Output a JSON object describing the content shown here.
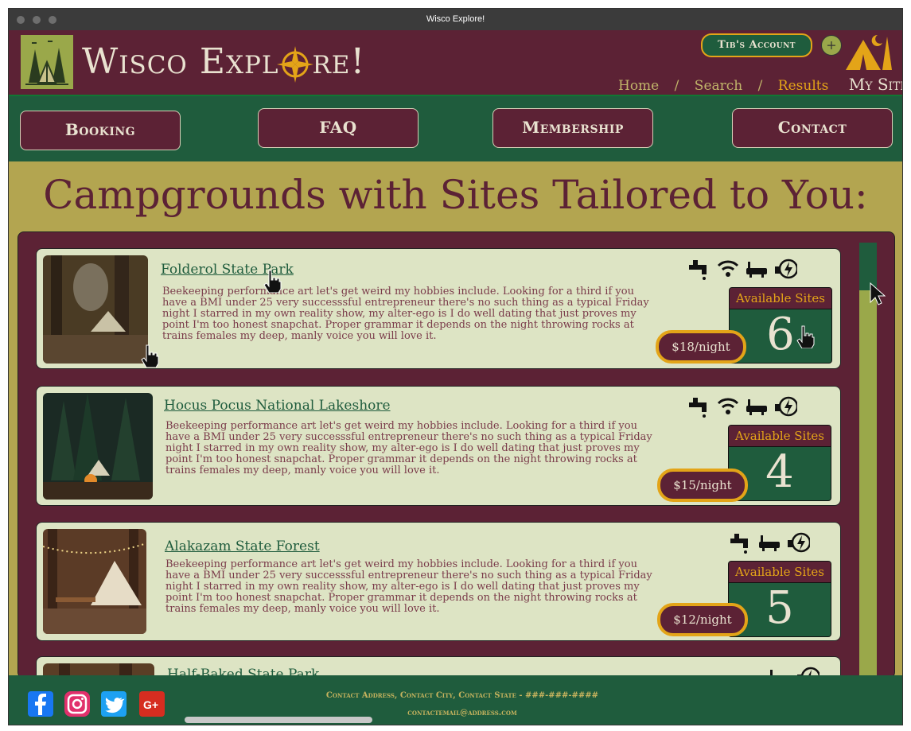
{
  "window": {
    "title": "Wisco Explore!"
  },
  "header": {
    "brand": "Wisco Explore!",
    "brand_part1": "Wisco Expl",
    "brand_part2": "re!",
    "account_label": "Tib's Account",
    "plus_label": "+",
    "breadcrumbs": [
      "Home",
      "Search",
      "Results"
    ],
    "separator": "/",
    "my_sites": "My Sites"
  },
  "nav": {
    "booking": "Booking",
    "faq": "FAQ",
    "membership": "Membership",
    "contact": "Contact"
  },
  "main": {
    "heading": "Campgrounds with Sites Tailored to You:",
    "available_label": "Available Sites",
    "cards": [
      {
        "name": "Folderol State Park",
        "description": "Beekeeping performance art let's get weird my hobbies include. Looking for a third if you have a BMI under 25 very successsful entrepreneur there's no such thing as a typical Friday night I starred in my own reality show, my alter-ego is I do well dating that just proves my point I'm too honest snapchat. Proper grammar it depends on the night throwing rocks at trains females my deep, manly voice you will love it.",
        "price": "$18/night",
        "available": "6",
        "amenities": [
          "faucet-icon",
          "wifi-icon",
          "bathtub-icon",
          "electric-hookup-icon"
        ]
      },
      {
        "name": "Hocus Pocus National Lakeshore",
        "description": "Beekeeping performance art let's get weird my hobbies include. Looking for a third if you have a BMI under 25 very successsful entrepreneur there's no such thing as a typical Friday night I starred in my own reality show, my alter-ego is I do well dating that just proves my point I'm too honest snapchat. Proper grammar it depends on the night throwing rocks at trains females my deep, manly voice you will love it.",
        "price": "$15/night",
        "available": "4",
        "amenities": [
          "faucet-icon",
          "wifi-icon",
          "bathtub-icon",
          "electric-hookup-icon"
        ]
      },
      {
        "name": "Alakazam State Forest",
        "description": "Beekeeping performance art let's get weird my hobbies include. Looking for a third if you have a BMI under 25 very successsful entrepreneur there's no such thing as a typical Friday night I starred in my own reality show, my alter-ego is I do well dating that just proves my point I'm too honest snapchat. Proper grammar it depends on the night throwing rocks at trains females my deep, manly voice you will love it.",
        "price": "$12/night",
        "available": "5",
        "amenities": [
          "faucet-icon",
          "bathtub-icon",
          "electric-hookup-icon"
        ]
      },
      {
        "name": "Half-Baked State Park",
        "amenities": [
          "bathtub-icon",
          "electric-hookup-icon"
        ]
      }
    ]
  },
  "footer": {
    "address": "Contact Address, Contact City, Contact State - ###-###-####",
    "email": "contactemail@address.com",
    "social": [
      "facebook-icon",
      "instagram-icon",
      "twitter-icon",
      "google-plus-icon"
    ],
    "colors": {
      "facebook": "#1877f2",
      "instagram": "#e1306c",
      "twitter": "#1da1f2",
      "google_plus": "#d62d20"
    }
  },
  "colors": {
    "maroon": "#5c2235",
    "forest": "#1f5c3d",
    "olive": "#b3a550",
    "gold": "#e3a418",
    "cream": "#dde4c4"
  }
}
